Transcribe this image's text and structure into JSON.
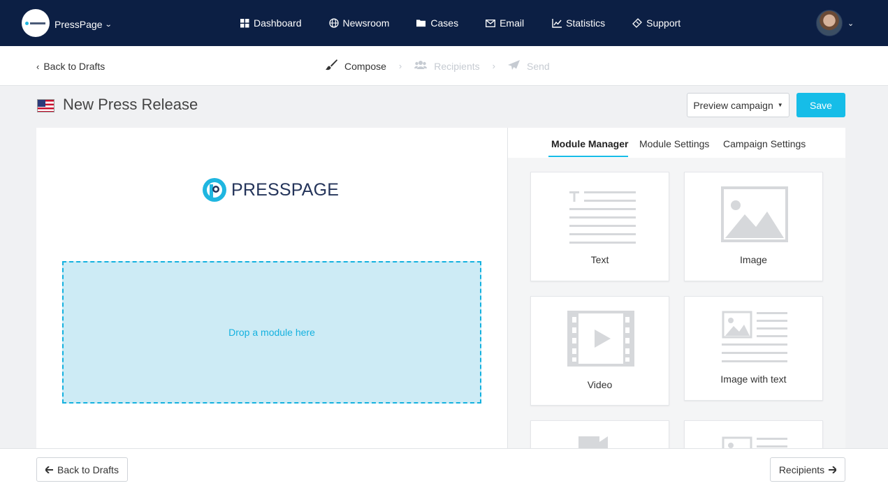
{
  "navbar": {
    "brand_name": "PressPage",
    "items": [
      {
        "label": "Dashboard",
        "icon": "grid-icon"
      },
      {
        "label": "Newsroom",
        "icon": "globe-icon"
      },
      {
        "label": "Cases",
        "icon": "folder-icon"
      },
      {
        "label": "Email",
        "icon": "envelope-icon"
      },
      {
        "label": "Statistics",
        "icon": "line-chart-icon"
      },
      {
        "label": "Support",
        "icon": "ticket-icon"
      }
    ]
  },
  "subbar": {
    "back_label": "Back to Drafts",
    "steps": [
      {
        "label": "Compose",
        "state": "active",
        "icon": "paintbrush-icon"
      },
      {
        "label": "Recipients",
        "state": "inactive",
        "icon": "users-icon"
      },
      {
        "label": "Send",
        "state": "inactive",
        "icon": "paper-plane-icon"
      }
    ]
  },
  "title": {
    "text": "New Press Release",
    "flag": "us-flag-icon"
  },
  "actions": {
    "preview_label": "Preview campaign",
    "save_label": "Save"
  },
  "canvas": {
    "logo_text": "PRESSPAGE",
    "dropzone_text": "Drop a module here"
  },
  "panel": {
    "tabs": [
      {
        "label": "Module Manager",
        "active": true
      },
      {
        "label": "Module Settings",
        "active": false
      },
      {
        "label": "Campaign Settings",
        "active": false
      }
    ],
    "modules": [
      {
        "label": "Text",
        "icon": "text-module-icon"
      },
      {
        "label": "Image",
        "icon": "image-module-icon"
      },
      {
        "label": "Video",
        "icon": "video-module-icon"
      },
      {
        "label": "Image with text",
        "icon": "image-text-module-icon"
      }
    ]
  },
  "footer": {
    "back_label": "Back to Drafts",
    "next_label": "Recipients"
  },
  "colors": {
    "navbar": "#0c1f44",
    "accent": "#16bde8",
    "dropzone_bg": "#cdebf5"
  }
}
